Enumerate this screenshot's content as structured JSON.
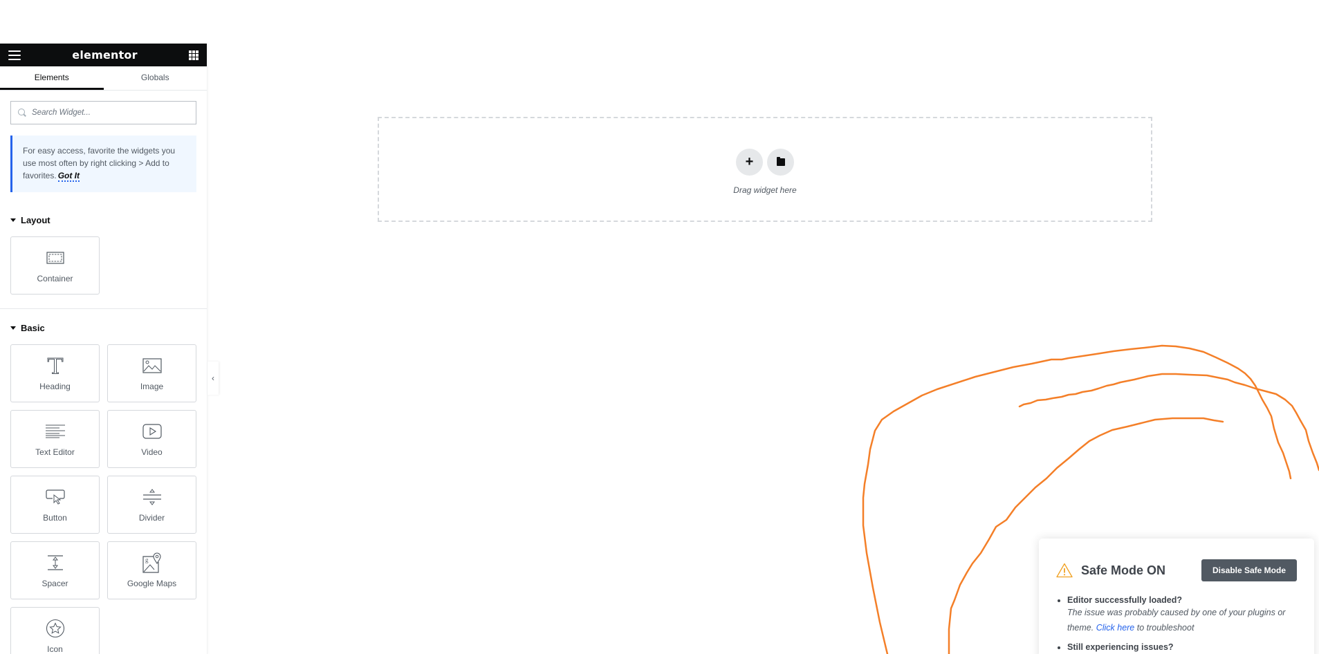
{
  "sidebar": {
    "logo": "elementor",
    "tabs": [
      {
        "label": "Elements",
        "active": true
      },
      {
        "label": "Globals",
        "active": false
      }
    ],
    "search": {
      "placeholder": "Search Widget...",
      "value": ""
    },
    "notice": {
      "text": "For easy access, favorite the widgets you use most often by right clicking > Add to favorites.",
      "link": "Got It"
    },
    "sections": [
      {
        "title": "Layout",
        "widgets": [
          {
            "label": "Container",
            "icon": "container-icon"
          }
        ]
      },
      {
        "title": "Basic",
        "widgets": [
          {
            "label": "Heading",
            "icon": "heading-icon"
          },
          {
            "label": "Image",
            "icon": "image-icon"
          },
          {
            "label": "Text Editor",
            "icon": "text-editor-icon"
          },
          {
            "label": "Video",
            "icon": "video-icon"
          },
          {
            "label": "Button",
            "icon": "button-icon"
          },
          {
            "label": "Divider",
            "icon": "divider-icon"
          },
          {
            "label": "Spacer",
            "icon": "spacer-icon"
          },
          {
            "label": "Google Maps",
            "icon": "google-maps-icon"
          },
          {
            "label": "Icon",
            "icon": "star-icon"
          }
        ]
      }
    ],
    "collapse_glyph": "‹"
  },
  "canvas": {
    "dropzone_text": "Drag widget here",
    "add_glyph": "+"
  },
  "annotation": {
    "stroke_color": "#f47f28"
  },
  "safe_mode": {
    "title": "Safe Mode ON",
    "disable_button": "Disable Safe Mode",
    "items": [
      {
        "question": "Editor successfully loaded?",
        "answer_before": "The issue was probably caused by one of your plugins or theme. ",
        "link": "Click here",
        "answer_after": " to troubleshoot"
      },
      {
        "question": "Still experiencing issues?"
      }
    ]
  }
}
